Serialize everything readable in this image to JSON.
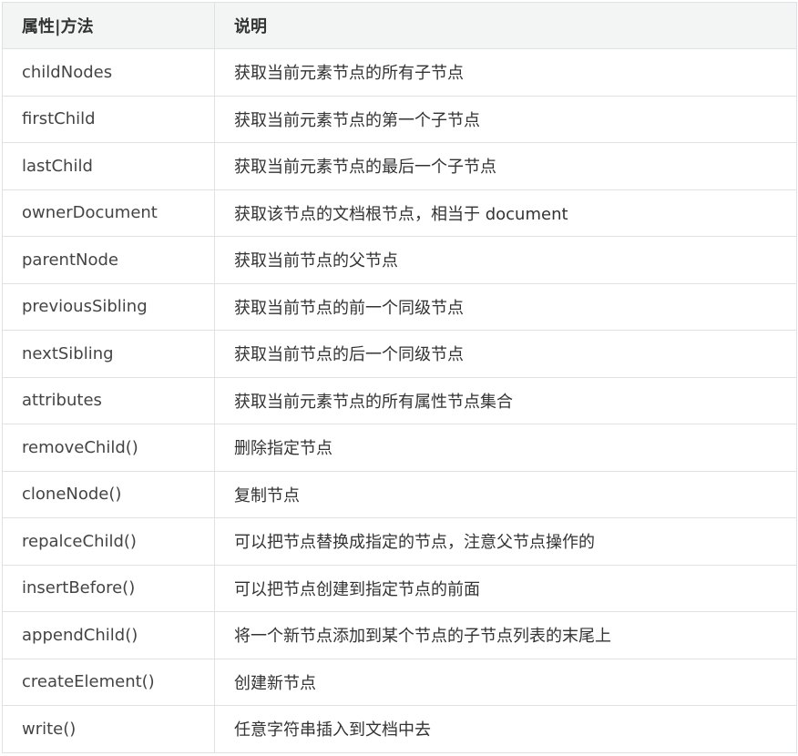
{
  "table": {
    "headers": [
      "属性|方法",
      "说明"
    ],
    "rows": [
      [
        "childNodes",
        "获取当前元素节点的所有子节点"
      ],
      [
        "firstChild",
        "获取当前元素节点的第一个子节点"
      ],
      [
        "lastChild",
        "获取当前元素节点的最后一个子节点"
      ],
      [
        "ownerDocument",
        "获取该节点的文档根节点，相当于 document"
      ],
      [
        "parentNode",
        "获取当前节点的父节点"
      ],
      [
        "previousSibling",
        "获取当前节点的前一个同级节点"
      ],
      [
        "nextSibling",
        "获取当前节点的后一个同级节点"
      ],
      [
        "attributes",
        "获取当前元素节点的所有属性节点集合"
      ],
      [
        "removeChild()",
        "删除指定节点"
      ],
      [
        "cloneNode()",
        "复制节点"
      ],
      [
        "repalceChild()",
        "可以把节点替换成指定的节点，注意父节点操作的"
      ],
      [
        "insertBefore()",
        "可以把节点创建到指定节点的前面"
      ],
      [
        "appendChild()",
        "将一个新节点添加到某个节点的子节点列表的末尾上"
      ],
      [
        "createElement()",
        "创建新节点"
      ],
      [
        "write()",
        "任意字符串插入到文档中去"
      ]
    ]
  }
}
